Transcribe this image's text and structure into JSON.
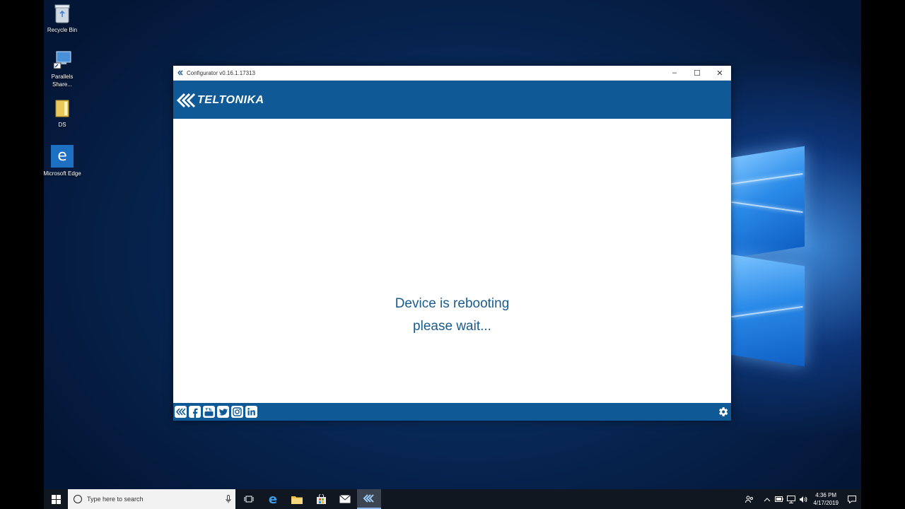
{
  "desktop": {
    "icons": [
      {
        "label": "Recycle Bin",
        "icon": "recycle-bin-icon"
      },
      {
        "label": "Parallels Share...",
        "icon": "parallels-icon"
      },
      {
        "label": "DS",
        "icon": "folder-icon"
      },
      {
        "label": "Microsoft Edge",
        "icon": "edge-icon"
      }
    ]
  },
  "window": {
    "title": "Configurator v0.16.1.17313",
    "controls": {
      "minimize": "–",
      "maximize": "☐",
      "close": "✕"
    },
    "brand": "TELTONIKA",
    "message_line1": "Device is rebooting",
    "message_line2": "please wait...",
    "footer_icons": [
      "teltonika-icon",
      "facebook-icon",
      "youtube-icon",
      "twitter-icon",
      "instagram-icon",
      "linkedin-icon"
    ],
    "colors": {
      "brand": "#0f5996",
      "message": "#1a5b8e"
    }
  },
  "taskbar": {
    "search_placeholder": "Type here to search",
    "apps": [
      "task-view-icon",
      "edge-icon",
      "file-explorer-icon",
      "store-icon",
      "mail-icon",
      "teltonika-configurator-icon"
    ],
    "time": "4:36 PM",
    "date": "4/17/2019"
  }
}
